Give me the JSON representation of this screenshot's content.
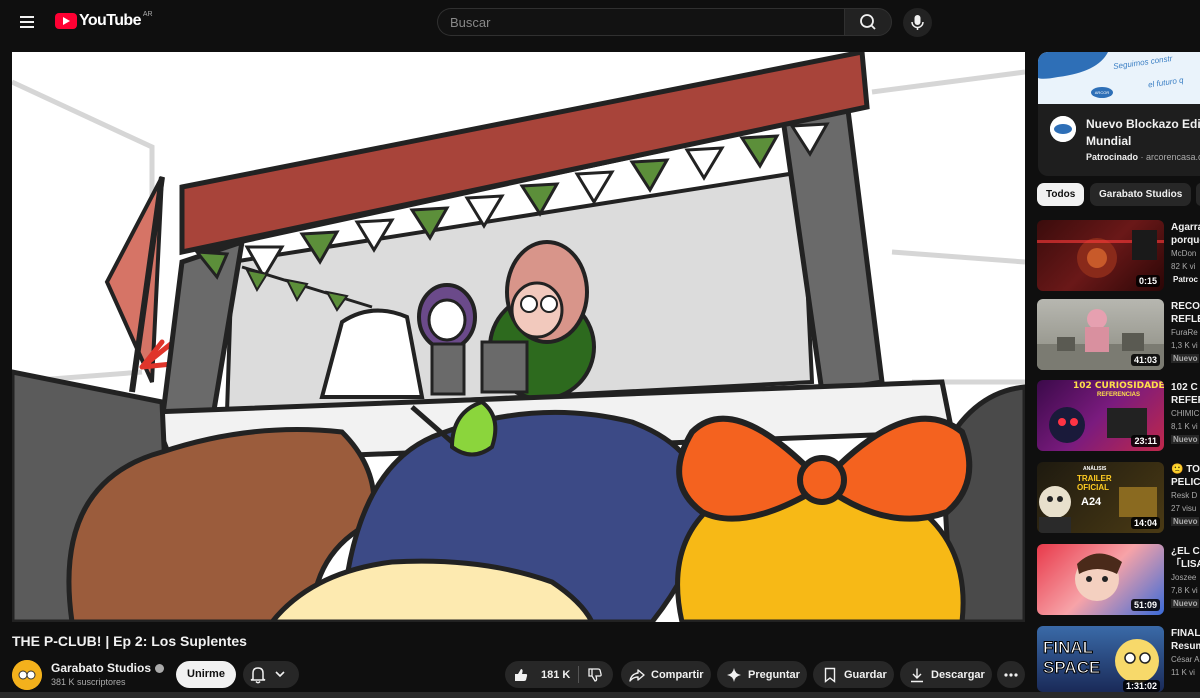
{
  "header": {
    "logo_text": "YouTube",
    "country_code": "AR",
    "search_placeholder": "Buscar"
  },
  "video": {
    "title": "THE P-CLUB! | Ep 2: Los Suplentes"
  },
  "channel": {
    "name": "Garabato Studios",
    "subscribers": "381 K suscriptores",
    "join_label": "Unirme"
  },
  "actions": {
    "like_count": "181 K",
    "share_label": "Compartir",
    "ask_label": "Preguntar",
    "save_label": "Guardar",
    "download_label": "Descargar"
  },
  "ad": {
    "banner_line1": "Seguimos constr",
    "banner_line2": "el futuro q",
    "logo_text": "ARCOR",
    "title": "Nuevo Blockazo Edic\nMundial",
    "sponsored_label": "Patrocinado",
    "domain": "arcorencasa.c"
  },
  "chips": [
    {
      "label": "Todos"
    },
    {
      "label": "Garabato Studios"
    }
  ],
  "recommendations": [
    {
      "title": "Agarra\nporque",
      "channel": "McDon",
      "views": "82 K vi",
      "badge": "Patroc",
      "duration": "0:15"
    },
    {
      "title": "RECO\nREFLE",
      "channel": "FuraRe",
      "views": "1,3 K vi",
      "badge": "Nuevo",
      "duration": "41:03",
      "thumb_text": ""
    },
    {
      "title": "102 C\nREFER",
      "channel": "CHIMIC",
      "views": "8,1 K vi",
      "badge": "Nuevo",
      "duration": "23:11",
      "thumb_text": "102 CURIOSIDADES",
      "thumb_sub": "REFERENCIAS"
    },
    {
      "title": "🙁 TO\nPELIC",
      "channel": "Resk D",
      "views": "27 visu",
      "badge": "Nuevo",
      "duration": "14:04",
      "thumb_text": "TRAILER OFICIAL",
      "thumb_sub": "A24",
      "thumb_kicker": "ANÁLISIS"
    },
    {
      "title": "¿EL CA\n「LISA",
      "channel": "Joszee",
      "views": "7,8 K vi",
      "badge": "Nuevo",
      "duration": "51:09"
    },
    {
      "title": "FINAL\nResum",
      "channel": "César A",
      "views": "11 K vi",
      "badge": "",
      "duration": "1:31:02",
      "thumb_text": "FINAL",
      "thumb_sub": "SPACE"
    }
  ],
  "colors": {
    "background": "#0f0f0f",
    "brand_red": "#ff0033",
    "chip_active": "#f1f1f1",
    "button_bg": "#272727"
  }
}
